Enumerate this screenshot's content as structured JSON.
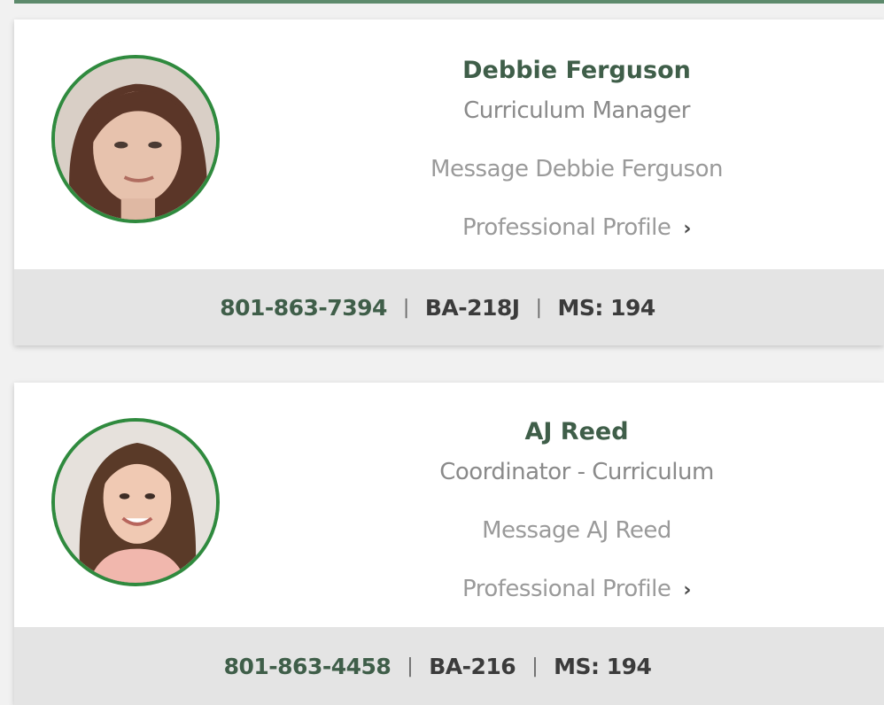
{
  "contacts": [
    {
      "name": "Debbie Ferguson",
      "title": "Curriculum Manager",
      "message_label": "Message Debbie Ferguson",
      "profile_label": "Professional Profile",
      "phone": "801-863-7394",
      "room": "BA-218J",
      "mailstop": "MS: 194"
    },
    {
      "name": "AJ Reed",
      "title": "Coordinator - Curriculum",
      "message_label": "Message AJ Reed",
      "profile_label": "Professional Profile",
      "phone": "801-863-4458",
      "room": "BA-216",
      "mailstop": "MS: 194"
    }
  ],
  "separator": "|",
  "chevron": "›",
  "colors": {
    "accent_green": "#2f8a3e",
    "name_green": "#3f5e49",
    "footer_bg": "#e4e4e4",
    "muted_text": "#9a9a9a"
  },
  "icons": {
    "profile_link": "chevron-right-icon"
  }
}
